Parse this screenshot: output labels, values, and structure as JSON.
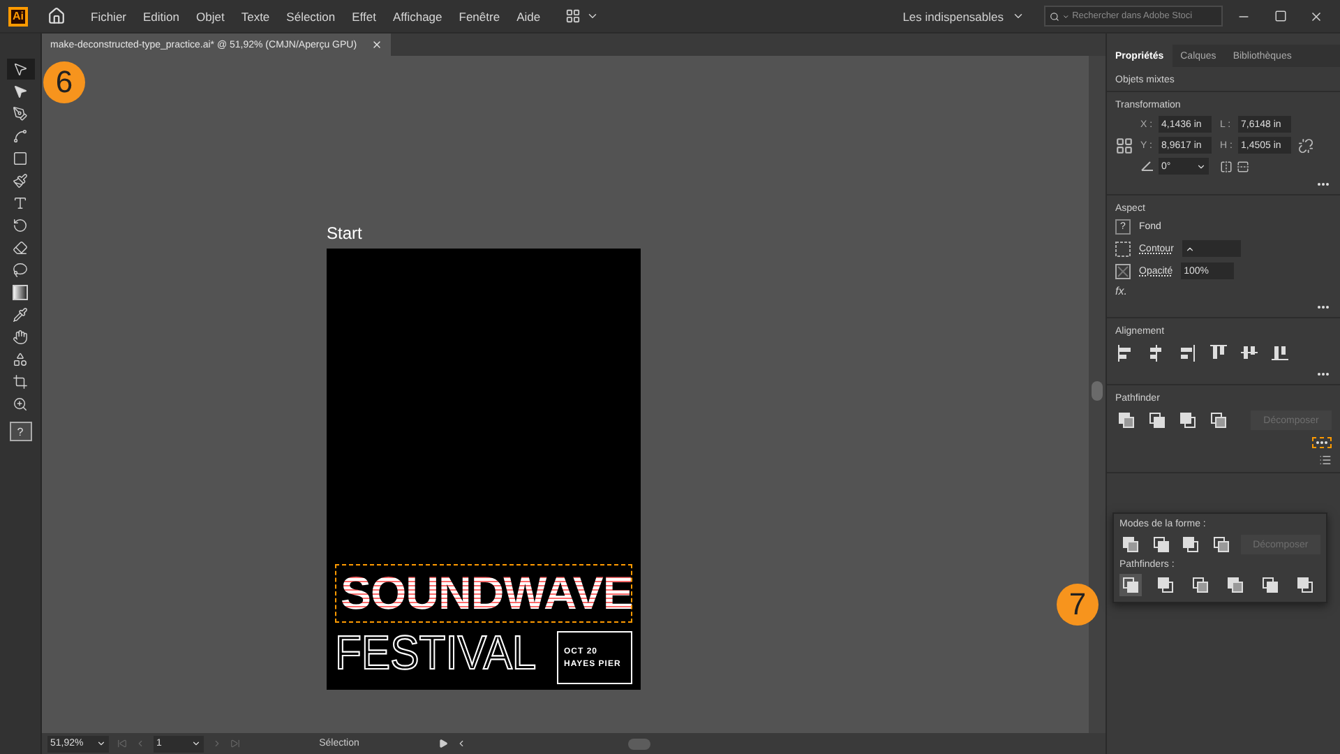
{
  "app": {
    "logo": "Ai"
  },
  "menu": [
    "Fichier",
    "Edition",
    "Objet",
    "Texte",
    "Sélection",
    "Effet",
    "Affichage",
    "Fenêtre",
    "Aide"
  ],
  "workspace": {
    "label": "Les indispensables"
  },
  "search": {
    "placeholder": "Rechercher dans Adobe Stoci"
  },
  "document_tab": {
    "title": "make-deconstructed-type_practice.ai* @ 51,92% (CMJN/Aperçu GPU)"
  },
  "tools": [
    {
      "kind": "selection",
      "selected": true
    },
    {
      "kind": "direct",
      "selected": false
    },
    {
      "kind": "pen",
      "selected": false
    },
    {
      "kind": "curvature",
      "selected": false
    },
    {
      "kind": "rectangle",
      "selected": false
    },
    {
      "kind": "brush",
      "selected": false
    },
    {
      "kind": "type",
      "selected": false
    },
    {
      "kind": "rotate",
      "selected": false
    },
    {
      "kind": "eraser",
      "selected": false
    },
    {
      "kind": "lasso",
      "selected": false
    },
    {
      "kind": "gradient",
      "selected": false
    },
    {
      "kind": "eyedropper",
      "selected": false
    },
    {
      "kind": "puppet",
      "selected": false
    },
    {
      "kind": "shapes",
      "selected": false
    },
    {
      "kind": "artboard",
      "selected": false
    },
    {
      "kind": "zoom",
      "selected": false
    }
  ],
  "fill_stroke": {
    "fill": "?"
  },
  "artboard": {
    "label": "Start",
    "headline": "SOUNDWAVE",
    "subhead": "FESTIVAL",
    "date": "OCT 20",
    "venue": "HAYES PIER"
  },
  "callouts": [
    {
      "number": "6"
    },
    {
      "number": "7"
    }
  ],
  "panel": {
    "tabs": [
      {
        "label": "Propriétés",
        "selected": true
      },
      {
        "label": "Calques",
        "selected": false
      },
      {
        "label": "Bibliothèques",
        "selected": false
      }
    ],
    "selection_type": "Objets mixtes",
    "transform": {
      "title": "Transformation",
      "fields": [
        {
          "label": "X :",
          "value": "4,1436 in"
        },
        {
          "label": "L :",
          "value": "7,6148 in"
        },
        {
          "label": "Y :",
          "value": "8,9617 in"
        },
        {
          "label": "H :",
          "value": "1,4505 in"
        }
      ],
      "angle": "0°"
    },
    "appearance": {
      "title": "Aspect",
      "fill_value": "?",
      "fill_label": "Fond",
      "stroke_label": "Contour",
      "opacity_label": "Opacité",
      "opacity_value": "100%",
      "fx": "fx."
    },
    "align": {
      "title": "Alignement"
    },
    "pathfinder": {
      "title": "Pathfinder",
      "button": {
        "label": "Décomposer",
        "disabled": true
      },
      "more_highlighted": true
    }
  },
  "pathfinder_popup": {
    "shape_modes_title": "Modes de la forme :",
    "expand": {
      "label": "Décomposer",
      "disabled": true
    },
    "pathfinders_title": "Pathfinders :",
    "pathfinders": [
      {
        "selected": true
      },
      {
        "selected": false
      },
      {
        "selected": false
      },
      {
        "selected": false
      },
      {
        "selected": false
      },
      {
        "selected": false
      }
    ]
  },
  "status": {
    "zoom": "51,92%",
    "artboard": "1",
    "tool": "Sélection"
  }
}
